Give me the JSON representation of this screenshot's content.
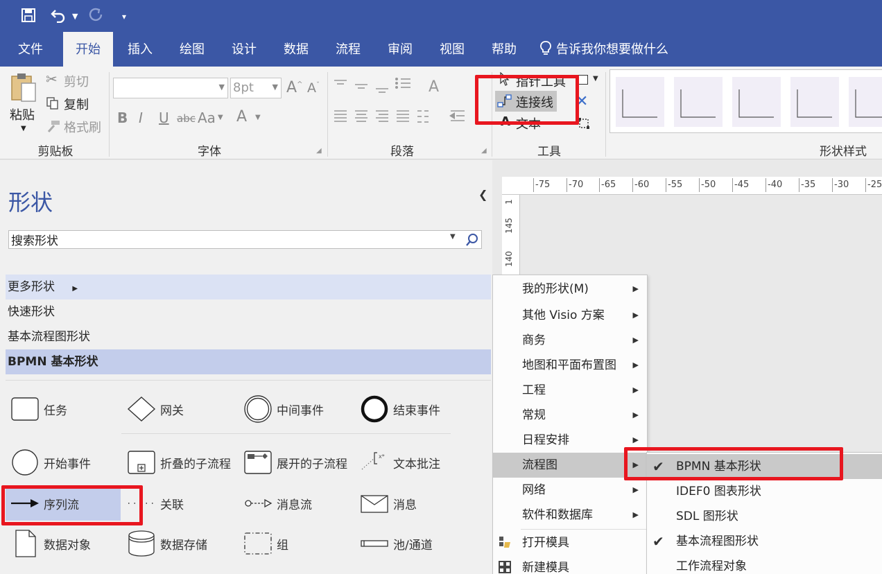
{
  "quick_access": {
    "save_icon": "save-icon",
    "undo_icon": "undo-icon",
    "redo_icon": "redo-icon",
    "customize_icon": "customize-icon"
  },
  "tabs": [
    {
      "label": "文件"
    },
    {
      "label": "开始"
    },
    {
      "label": "插入"
    },
    {
      "label": "绘图"
    },
    {
      "label": "设计"
    },
    {
      "label": "数据"
    },
    {
      "label": "流程"
    },
    {
      "label": "审阅"
    },
    {
      "label": "视图"
    },
    {
      "label": "帮助"
    }
  ],
  "tell_me": "告诉我你想要做什么",
  "ribbon": {
    "clipboard": {
      "paste": "粘贴",
      "cut": "剪切",
      "copy": "复制",
      "format_painter": "格式刷",
      "label": "剪贴板"
    },
    "font": {
      "font_name": "",
      "font_size": "8pt",
      "bold": "B",
      "italic": "I",
      "underline": "U",
      "strike": "abc",
      "case": "Aa",
      "color": "A",
      "label": "字体"
    },
    "paragraph": {
      "label": "段落"
    },
    "tools": {
      "pointer": "指针工具",
      "connector": "连接线",
      "text": "文本",
      "label": "工具"
    },
    "shape_styles": {
      "label": "形状样式"
    }
  },
  "shapes_panel": {
    "title": "形状",
    "search_placeholder": "搜索形状",
    "stencils": [
      {
        "label": "更多形状"
      },
      {
        "label": "快速形状"
      },
      {
        "label": "基本流程图形状"
      },
      {
        "label": "BPMN 基本形状"
      }
    ],
    "shapes": [
      {
        "label": "任务"
      },
      {
        "label": "网关"
      },
      {
        "label": "中间事件"
      },
      {
        "label": "结束事件"
      },
      {
        "label": "开始事件"
      },
      {
        "label": "折叠的子流程"
      },
      {
        "label": "展开的子流程"
      },
      {
        "label": "文本批注"
      },
      {
        "label": "序列流"
      },
      {
        "label": "关联"
      },
      {
        "label": "消息流"
      },
      {
        "label": "消息"
      },
      {
        "label": "数据对象"
      },
      {
        "label": "数据存储"
      },
      {
        "label": "组"
      },
      {
        "label": "池/通道"
      }
    ]
  },
  "ruler": {
    "h_ticks": [
      "-75",
      "-70",
      "-65",
      "-60",
      "-55",
      "-50",
      "-45",
      "-40",
      "-35",
      "-30",
      "-25"
    ],
    "v_ticks": [
      "1",
      "145",
      "140"
    ]
  },
  "more_shapes_menu": [
    {
      "label": "我的形状(M)"
    },
    {
      "label": "其他 Visio 方案"
    },
    {
      "label": "商务"
    },
    {
      "label": "地图和平面布置图"
    },
    {
      "label": "工程"
    },
    {
      "label": "常规"
    },
    {
      "label": "日程安排"
    },
    {
      "label": "流程图"
    },
    {
      "label": "网络"
    },
    {
      "label": "软件和数据库"
    },
    {
      "label": "打开模具"
    },
    {
      "label": "新建模具"
    }
  ],
  "flowchart_submenu": [
    {
      "label": "BPMN 基本形状",
      "checked": true
    },
    {
      "label": "IDEF0 图表形状",
      "checked": false
    },
    {
      "label": "SDL 图形状",
      "checked": false
    },
    {
      "label": "基本流程图形状",
      "checked": true
    },
    {
      "label": "工作流程对象",
      "checked": false
    }
  ],
  "colors": {
    "brand": "#3b57a5",
    "highlight_red": "#e8161f",
    "stencil_selected": "#c3cdeb",
    "stencil_hover": "#dbe2f4"
  }
}
